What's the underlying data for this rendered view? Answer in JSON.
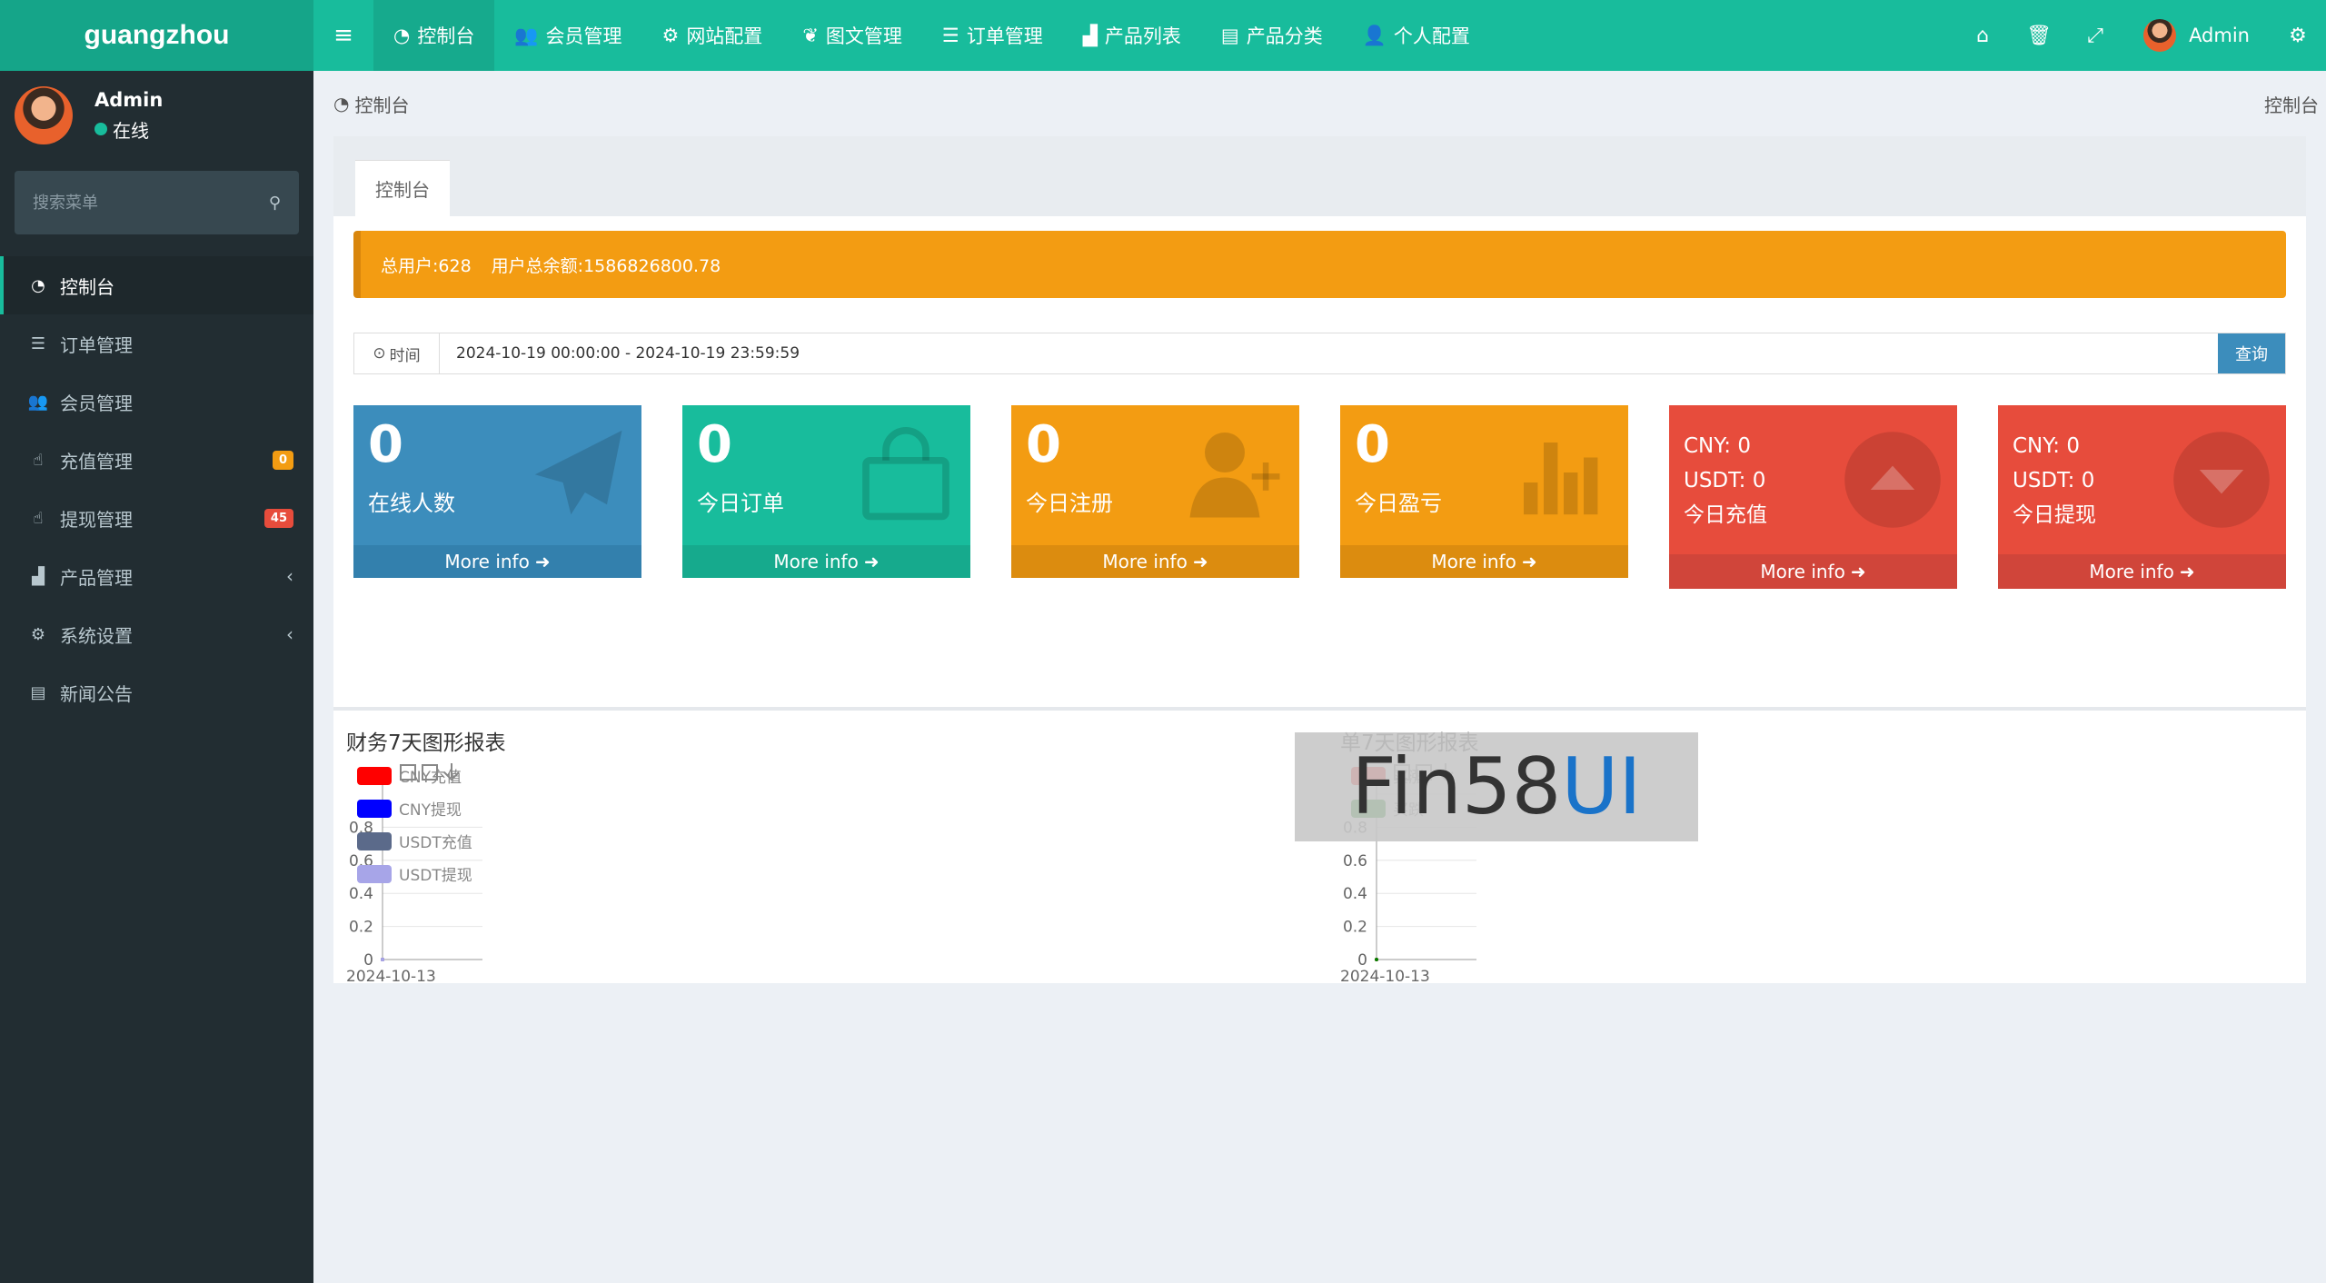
{
  "app": {
    "logo": "guangzhou"
  },
  "topnav": [
    {
      "label": "控制台",
      "icon": "dashboard-icon",
      "active": true
    },
    {
      "label": "会员管理",
      "icon": "users-icon"
    },
    {
      "label": "网站配置",
      "icon": "gear-icon"
    },
    {
      "label": "图文管理",
      "icon": "leaf-icon"
    },
    {
      "label": "订单管理",
      "icon": "list-icon"
    },
    {
      "label": "产品列表",
      "icon": "shopping-bag-icon"
    },
    {
      "label": "产品分类",
      "icon": "table-icon"
    },
    {
      "label": "个人配置",
      "icon": "user-icon"
    }
  ],
  "topright": {
    "user_name": "Admin"
  },
  "sidebar": {
    "user": {
      "name": "Admin",
      "status": "在线"
    },
    "search_placeholder": "搜索菜单",
    "items": [
      {
        "label": "控制台",
        "icon": "dashboard-icon",
        "active": true
      },
      {
        "label": "订单管理",
        "icon": "list-icon"
      },
      {
        "label": "会员管理",
        "icon": "users-icon"
      },
      {
        "label": "充值管理",
        "icon": "hand-icon",
        "badge": "0",
        "badge_color": "#f39c12"
      },
      {
        "label": "提现管理",
        "icon": "hand-icon",
        "badge": "45",
        "badge_color": "#e74c3c"
      },
      {
        "label": "产品管理",
        "icon": "shopping-bag-icon",
        "chevron": "‹"
      },
      {
        "label": "系统设置",
        "icon": "gears-icon",
        "chevron": "‹"
      },
      {
        "label": "新闻公告",
        "icon": "newspaper-icon"
      }
    ]
  },
  "breadcrumb": {
    "current": "控制台",
    "right": "控制台"
  },
  "tab": {
    "label": "控制台"
  },
  "alert": {
    "total_users": "总用户:628",
    "total_balance": "用户总余额:1586826800.78"
  },
  "filter": {
    "addon_label": "时间",
    "range": "2024-10-19 00:00:00 - 2024-10-19 23:59:59",
    "button": "查询"
  },
  "stat_boxes": [
    {
      "value": "0",
      "label": "在线人数",
      "more": "More info",
      "color": "#3c8dbc",
      "footer_color": "#3380ad",
      "icon": "paper-plane-icon"
    },
    {
      "value": "0",
      "label": "今日订单",
      "more": "More info",
      "color": "#18bc9c",
      "footer_color": "#16aa8d",
      "icon": "shopping-bag-icon"
    },
    {
      "value": "0",
      "label": "今日注册",
      "more": "More info",
      "color": "#f39c12",
      "footer_color": "#dc8c0f",
      "icon": "user-plus-icon"
    },
    {
      "value": "0",
      "label": "今日盈亏",
      "more": "More info",
      "color": "#f39c12",
      "footer_color": "#dc8c0f",
      "icon": "bar-chart-icon"
    }
  ],
  "money_boxes": [
    {
      "cny": "CNY:  0",
      "usdt": "USDT:  0",
      "label": "今日充值",
      "more": "More info",
      "color": "#e74c3c",
      "footer_color": "#d0453a",
      "icon": "arrow-up-circle-icon"
    },
    {
      "cny": "CNY:  0",
      "usdt": "USDT:  0",
      "label": "今日提现",
      "more": "More info",
      "color": "#e74c3c",
      "footer_color": "#d0453a",
      "icon": "arrow-down-circle-icon"
    }
  ],
  "charts": [
    {
      "title": "财务7天图形报表",
      "legend": [
        "CNY充值",
        "CNY提现",
        "USDT充值",
        "USDT提现"
      ],
      "legend_colors": [
        "#ff0000",
        "#0000ff",
        "#5b6a8a",
        "#a7a5e8"
      ]
    },
    {
      "title": "单7天图形报表",
      "legend": [
        "买涨",
        "买跌"
      ],
      "legend_colors": [
        "#ff0000",
        "#008000"
      ]
    }
  ],
  "chart_data": [
    {
      "type": "line",
      "title": "财务7天图形报表",
      "x": [
        "2024-10-13"
      ],
      "series": [
        {
          "name": "CNY充值",
          "values": [
            0
          ]
        },
        {
          "name": "CNY提现",
          "values": [
            0
          ]
        },
        {
          "name": "USDT充值",
          "values": [
            0
          ]
        },
        {
          "name": "USDT提现",
          "values": [
            0
          ]
        }
      ],
      "yticks": [
        "0",
        "0.2",
        "0.4",
        "0.6",
        "0.8"
      ],
      "ylim": [
        0,
        1
      ],
      "xticks": [
        "2024-10-13"
      ]
    },
    {
      "type": "line",
      "title": "单7天图形报表",
      "x": [
        "2024-10-13"
      ],
      "series": [
        {
          "name": "买涨",
          "values": [
            0
          ]
        },
        {
          "name": "买跌",
          "values": [
            0
          ]
        }
      ],
      "yticks": [
        "0",
        "0.2",
        "0.4",
        "0.6",
        "0.8",
        "1"
      ],
      "ylim": [
        0,
        1
      ],
      "xticks": [
        "2024-10-13"
      ]
    }
  ],
  "watermark": {
    "part1": "Fin58",
    "part2": "UI"
  }
}
